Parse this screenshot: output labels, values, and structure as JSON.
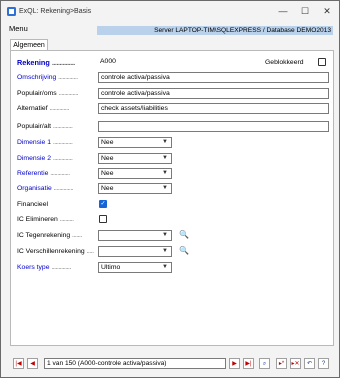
{
  "window": {
    "title": "ExQL: Rekening>Basis",
    "buttons": {
      "minimize": "—",
      "maximize": "☐",
      "close": "✕"
    }
  },
  "menu": {
    "label": "Menu"
  },
  "server_info": "Server LAPTOP-TIM\\SQLEXPRESS / Database DEMO2013",
  "tabs": [
    {
      "label": "Algemeen"
    }
  ],
  "form": {
    "rekening": {
      "label": "Rekening",
      "dots": "...............",
      "value": "A000"
    },
    "geblokkeerd": {
      "label": "Geblokkeerd",
      "checked": false
    },
    "omschrijving": {
      "label": "Omschrijving",
      "dots": "..............",
      "value": "controle activa/passiva"
    },
    "populair_oms": {
      "label": "Populair/oms",
      "dots": "..............",
      "value": "controle activa/passiva"
    },
    "alternatief": {
      "label": "Alternatief",
      "dots": "..............",
      "value": "check assets/liabilities"
    },
    "populair_alt": {
      "label": "Populair/alt",
      "dots": "..............",
      "value": ""
    },
    "dimensie1": {
      "label": "Dimensie 1",
      "dots": "..............",
      "value": "Nee"
    },
    "dimensie2": {
      "label": "Dimensie 2",
      "dots": "..............",
      "value": "Nee"
    },
    "referentie": {
      "label": "Referentie",
      "dots": "..............",
      "value": "Nee"
    },
    "organisatie": {
      "label": "Organisatie",
      "dots": "..............",
      "value": "Nee"
    },
    "financieel": {
      "label": "Financieel",
      "checked": true
    },
    "ic_elimineren": {
      "label": "IC Elimineren",
      "dots": "..........",
      "checked": false
    },
    "ic_tegenrekening": {
      "label": "IC Tegenrekening",
      "dots": ".......",
      "value": ""
    },
    "ic_verschillenrekening": {
      "label": "IC Verschillenrekening",
      "dots": ".....",
      "value": ""
    },
    "koers_type": {
      "label": "Koers type",
      "dots": "..............",
      "value": "Ultimo"
    }
  },
  "navigation": {
    "record_info": "1 van 150 (A000-controle activa/passiva)"
  },
  "icons": {
    "binoculars": "binoculars-icon"
  }
}
